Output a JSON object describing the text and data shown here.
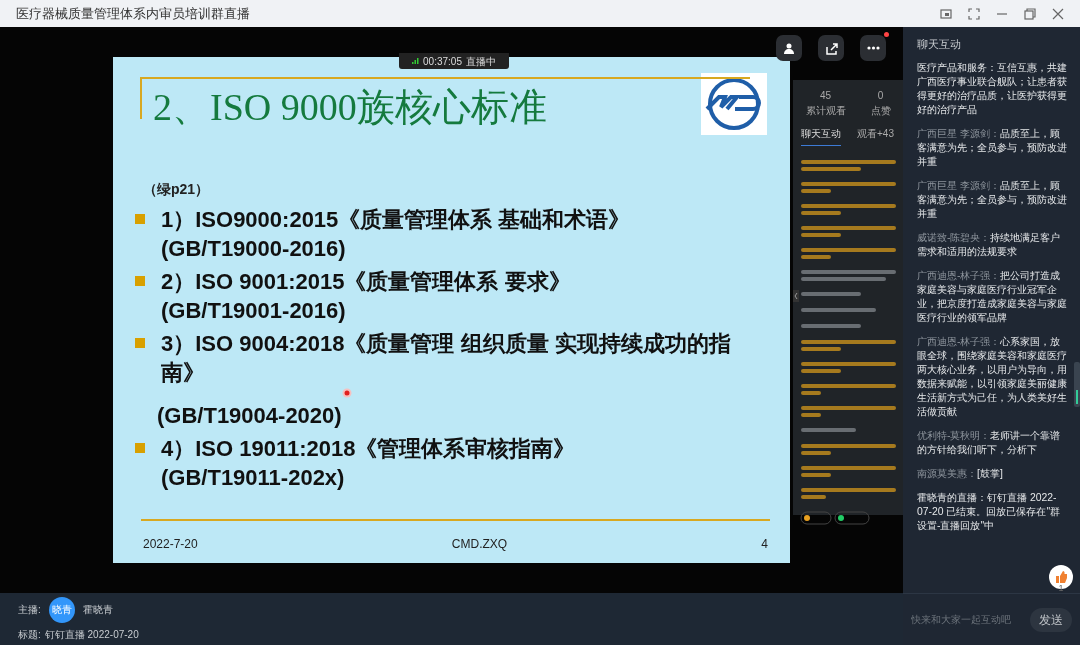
{
  "window": {
    "title": "医疗器械质量管理体系内审员培训群直播"
  },
  "live_status": {
    "time": "00:37:05",
    "label": "直播中"
  },
  "slide": {
    "title": "2、ISO 9000族核心标准",
    "lines": [
      {
        "kind": "note",
        "text": "（绿p21）"
      },
      {
        "kind": "bullet",
        "text": "1）ISO9000:2015《质量管理体系  基础和术语》",
        "sub": "(GB/T19000-2016)"
      },
      {
        "kind": "bullet",
        "text": "2）ISO 9001:2015《质量管理体系  要求》",
        "sub": "(GB/T19001-2016)"
      },
      {
        "kind": "bullet",
        "text": "3）ISO 9004:2018《质量管理 组织质量  实现持续成功的指南》"
      },
      {
        "kind": "plain",
        "text": "(GB/T19004-2020)"
      },
      {
        "kind": "bullet",
        "text": "4）ISO 19011:2018《管理体系审核指南》",
        "sub": "(GB/T19011-202x)"
      }
    ],
    "footer": {
      "date": "2022-7-20",
      "author": "CMD.ZXQ",
      "page": "4"
    }
  },
  "shared_panel": {
    "stats": [
      {
        "value": "45",
        "label": "累计观看"
      },
      {
        "value": "0",
        "label": "点赞"
      }
    ],
    "tabs": [
      {
        "label": "聊天互动",
        "selected": true
      },
      {
        "label": "观看+43",
        "selected": false
      }
    ]
  },
  "chat": {
    "title": "聊天互动",
    "messages": [
      {
        "kind": "system",
        "text": "医疗产品和服务：互信互惠，共建广西医疗事业联合舰队；让患者获得更好的治疗品质，让医护获得更好的治疗产品"
      },
      {
        "kind": "user",
        "author": "广西巨星 李源剑：",
        "text": "品质至上，顾客满意为先；全员参与，预防改进并重"
      },
      {
        "kind": "user",
        "author": "广西巨星 李源剑：",
        "text": "品质至上，顾客满意为先；全员参与，预防改进并重"
      },
      {
        "kind": "user",
        "author": "威诺致-陈碧央：",
        "text": "持续地满足客户需求和适用的法规要求"
      },
      {
        "kind": "user",
        "author": "广西迪恩-林子强：",
        "text": "把公司打造成家庭美容与家庭医疗行业冠军企业，把京度打造成家庭美容与家庭医疗行业的领军品牌"
      },
      {
        "kind": "user",
        "author": "广西迪恩-林子强：",
        "text": "心系家国，放眼全球，围绕家庭美容和家庭医疗两大核心业务，以用户为导向，用数据来赋能，以引领家庭美丽健康生活新方式为己任，为人类美好生活做贡献"
      },
      {
        "kind": "user",
        "author": "优利特-莫秋明：",
        "text": "老师讲一个靠谱的方针给我们听下，分析下"
      },
      {
        "kind": "user",
        "author": "南源莫美惠：",
        "text": "[鼓掌]"
      },
      {
        "kind": "system",
        "text": "霍晓青的直播：钉钉直播 2022-07-20 已结束。回放已保存在\"群设置-直播回放\"中"
      }
    ],
    "like_count": "1",
    "input": {
      "placeholder": "快来和大家一起互动吧"
    },
    "send": "发送"
  },
  "footer": {
    "host_label": "主播:",
    "avatar": "晓青",
    "host": "霍晓青",
    "title_label": "标题:",
    "title": "钉钉直播 2022-07-20"
  }
}
